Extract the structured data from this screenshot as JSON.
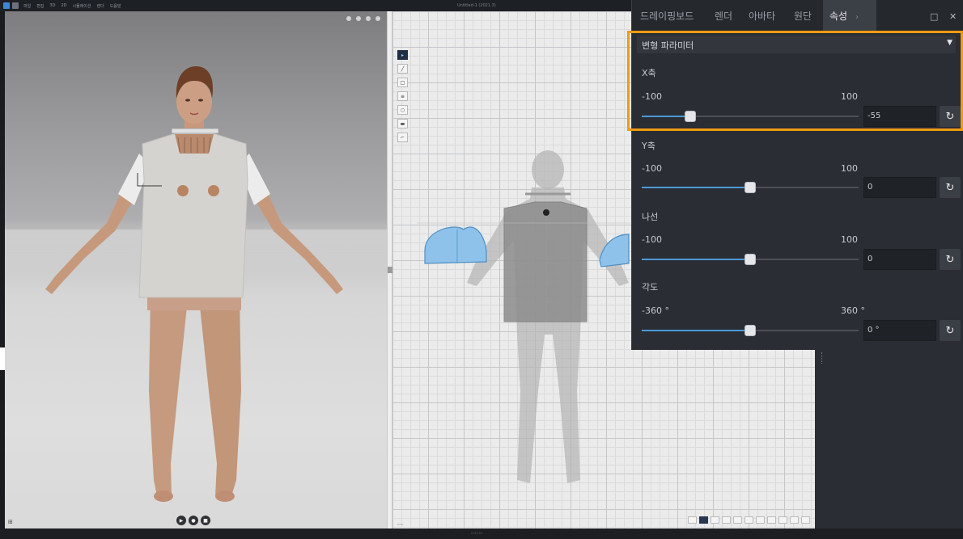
{
  "app": {
    "menu_items": [
      "파일",
      "편집",
      "3D",
      "2D",
      "시뮬레이션",
      "렌더",
      "도움말"
    ],
    "document_title": "Untitled-1 (2021.3)"
  },
  "panel": {
    "tabs": [
      {
        "label": "드레이핑보드",
        "active": false
      },
      {
        "label": "렌더",
        "active": false
      },
      {
        "label": "아바타",
        "active": false
      },
      {
        "label": "원단",
        "active": false
      },
      {
        "label": "속성",
        "active": true
      }
    ],
    "section_title": "변형 파라미터",
    "params": [
      {
        "label": "X축",
        "min": "-100",
        "max": "100",
        "value": "-55",
        "fraction": 0.225
      },
      {
        "label": "Y축",
        "min": "-100",
        "max": "100",
        "value": "0",
        "fraction": 0.5
      },
      {
        "label": "나선",
        "min": "-100",
        "max": "100",
        "value": "0",
        "fraction": 0.5
      },
      {
        "label": "각도",
        "min": "-360 °",
        "max": "360 °",
        "value": "0 °",
        "fraction": 0.5
      }
    ],
    "accent_color": "#4a9ad8",
    "highlight_color": "#f09a14"
  },
  "viewport": {
    "corner_label": "⊞",
    "player_icons": [
      "play-icon",
      "record-icon",
      "stop-icon"
    ]
  },
  "pattern_window": {
    "tool_icons": [
      "select-icon",
      "line-icon",
      "rect-icon",
      "stitch-icon",
      "circle-icon",
      "segment-icon",
      "fold-icon"
    ]
  }
}
